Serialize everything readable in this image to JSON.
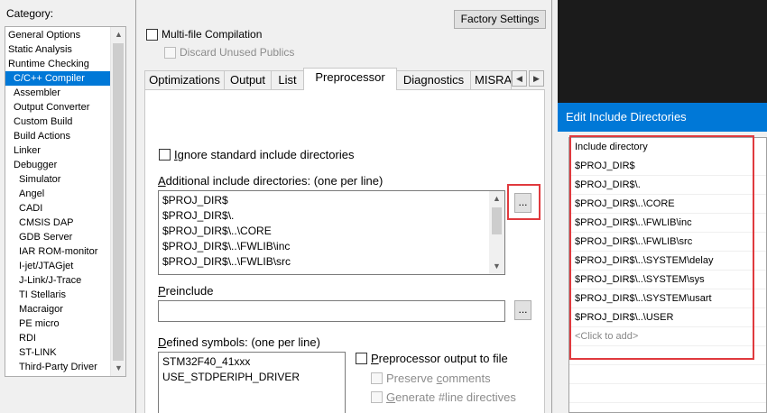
{
  "category": {
    "label": "Category:",
    "items": [
      {
        "label": "General Options",
        "level": 1
      },
      {
        "label": "Static Analysis",
        "level": 1
      },
      {
        "label": "Runtime Checking",
        "level": 1
      },
      {
        "label": "C/C++ Compiler",
        "level": 2,
        "selected": true
      },
      {
        "label": "Assembler",
        "level": 2
      },
      {
        "label": "Output Converter",
        "level": 2
      },
      {
        "label": "Custom Build",
        "level": 2
      },
      {
        "label": "Build Actions",
        "level": 2
      },
      {
        "label": "Linker",
        "level": 2
      },
      {
        "label": "Debugger",
        "level": 2
      },
      {
        "label": "Simulator",
        "level": 3
      },
      {
        "label": "Angel",
        "level": 3
      },
      {
        "label": "CADI",
        "level": 3
      },
      {
        "label": "CMSIS DAP",
        "level": 3
      },
      {
        "label": "GDB Server",
        "level": 3
      },
      {
        "label": "IAR ROM-monitor",
        "level": 3
      },
      {
        "label": "I-jet/JTAGjet",
        "level": 3
      },
      {
        "label": "J-Link/J-Trace",
        "level": 3
      },
      {
        "label": "TI Stellaris",
        "level": 3
      },
      {
        "label": "Macraigor",
        "level": 3
      },
      {
        "label": "PE micro",
        "level": 3
      },
      {
        "label": "RDI",
        "level": 3
      },
      {
        "label": "ST-LINK",
        "level": 3
      },
      {
        "label": "Third-Party Driver",
        "level": 3
      }
    ]
  },
  "options": {
    "factory_settings": "Factory Settings",
    "multifile": "Multi-file Compilation",
    "discard": "Discard Unused Publics",
    "tabs": [
      "Optimizations",
      "Output",
      "List",
      "Preprocessor",
      "Diagnostics",
      "MISRA"
    ],
    "active_tab": "Preprocessor",
    "ignore_std_first": "I",
    "ignore_std_rest": "gnore standard include directories",
    "include_dirs_label_first": "A",
    "include_dirs_label_rest": "dditional include directories: (one per line)",
    "include_dirs": [
      "$PROJ_DIR$",
      "$PROJ_DIR$\\.",
      "$PROJ_DIR$\\..\\CORE",
      "$PROJ_DIR$\\..\\FWLIB\\inc",
      "$PROJ_DIR$\\..\\FWLIB\\src"
    ],
    "dots": "...",
    "preinclude_first": "P",
    "preinclude_rest": "reinclude",
    "preinclude_value": "",
    "defined_label_first": "D",
    "defined_label_rest": "efined symbols: (one per line)",
    "defined_symbols": [
      "STM32F40_41xxx",
      "USE_STDPERIPH_DRIVER"
    ],
    "pp_output_first": "P",
    "pp_output_rest": "reprocessor output to file",
    "preserve_a": "Preserve ",
    "preserve_u": "c",
    "preserve_b": "omments",
    "generate_a": "",
    "generate_u": "G",
    "generate_b": "enerate #line directives"
  },
  "dialog": {
    "title": "Edit Include Directories",
    "header": "Include directory",
    "dirs": [
      "$PROJ_DIR$",
      "$PROJ_DIR$\\.",
      "$PROJ_DIR$\\..\\CORE",
      "$PROJ_DIR$\\..\\FWLIB\\inc",
      "$PROJ_DIR$\\..\\FWLIB\\src",
      "$PROJ_DIR$\\..\\SYSTEM\\delay",
      "$PROJ_DIR$\\..\\SYSTEM\\sys",
      "$PROJ_DIR$\\..\\SYSTEM\\usart",
      "$PROJ_DIR$\\..\\USER"
    ],
    "placeholder": "<Click to add>"
  },
  "colors": {
    "selection": "#0078d7",
    "highlight_frame": "#e03a3e",
    "dialog_title_bg": "#0078d7"
  }
}
